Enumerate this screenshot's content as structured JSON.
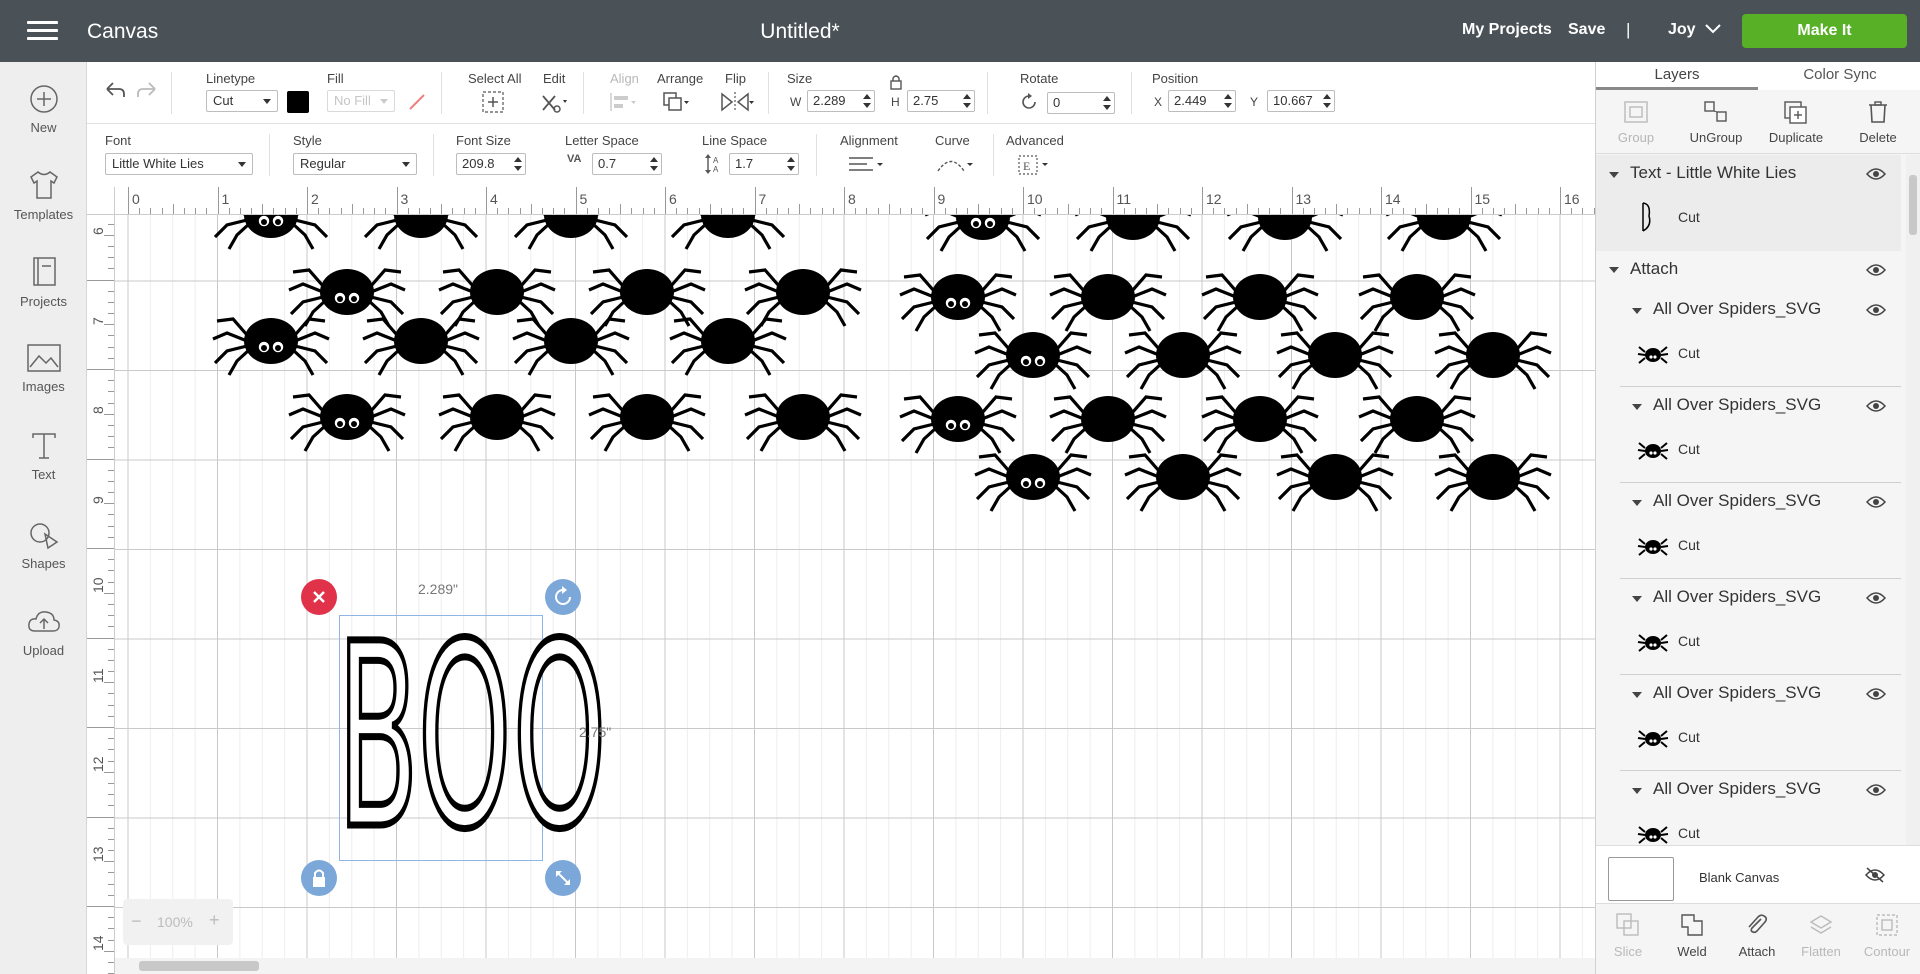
{
  "header": {
    "app_name": "Canvas",
    "doc_title": "Untitled*",
    "my_projects": "My Projects",
    "save": "Save",
    "separator": "|",
    "user": "Joy",
    "make_it": "Make It"
  },
  "sidebar": {
    "items": [
      {
        "label": "New",
        "icon": "plus-circle-icon"
      },
      {
        "label": "Templates",
        "icon": "shirt-icon"
      },
      {
        "label": "Projects",
        "icon": "book-icon"
      },
      {
        "label": "Images",
        "icon": "image-icon"
      },
      {
        "label": "Text",
        "icon": "text-icon"
      },
      {
        "label": "Shapes",
        "icon": "shapes-icon"
      },
      {
        "label": "Upload",
        "icon": "cloud-upload-icon"
      }
    ]
  },
  "toolbar1": {
    "linetype_label": "Linetype",
    "linetype_value": "Cut",
    "fill_label": "Fill",
    "fill_value": "No Fill",
    "select_all": "Select All",
    "edit": "Edit",
    "align": "Align",
    "arrange": "Arrange",
    "flip": "Flip",
    "size_label": "Size",
    "w_label": "W",
    "w_value": "2.289",
    "h_label": "H",
    "h_value": "2.75",
    "rotate_label": "Rotate",
    "rotate_value": "0",
    "position_label": "Position",
    "x_label": "X",
    "x_value": "2.449",
    "y_label": "Y",
    "y_value": "10.667",
    "color_swatch": "#000000"
  },
  "toolbar2": {
    "font_label": "Font",
    "font_value": "Little White Lies",
    "style_label": "Style",
    "style_value": "Regular",
    "font_size_label": "Font Size",
    "font_size_value": "209.8",
    "letter_space_label": "Letter Space",
    "letter_space_value": "0.7",
    "line_space_label": "Line Space",
    "line_space_value": "1.7",
    "alignment_label": "Alignment",
    "curve_label": "Curve",
    "advanced_label": "Advanced",
    "va_label": "VA"
  },
  "canvas": {
    "ruler_top": [
      "0",
      "1",
      "2",
      "3",
      "4",
      "5",
      "6",
      "7",
      "8",
      "9",
      "10",
      "11",
      "12",
      "13",
      "14",
      "15",
      "16"
    ],
    "ruler_left": [
      "6",
      "7",
      "8",
      "9",
      "10",
      "11",
      "12",
      "13",
      "14"
    ],
    "selected_text": "BOO",
    "width_label": "2.289\"",
    "height_label": "2.75\"",
    "zoom": "100%",
    "zoom_minus": "−",
    "zoom_plus": "+"
  },
  "panel": {
    "tabs": [
      "Layers",
      "Color Sync"
    ],
    "actions": [
      {
        "label": "Group",
        "disabled": true
      },
      {
        "label": "UnGroup",
        "disabled": false
      },
      {
        "label": "Duplicate",
        "disabled": false
      },
      {
        "label": "Delete",
        "disabled": false
      }
    ],
    "text_layer": {
      "title": "Text - Little White Lies",
      "sub": "Cut"
    },
    "attach_group": "Attach",
    "spider_layers": [
      {
        "title": "All Over Spiders_SVG",
        "sub": "Cut"
      },
      {
        "title": "All Over Spiders_SVG",
        "sub": "Cut"
      },
      {
        "title": "All Over Spiders_SVG",
        "sub": "Cut"
      },
      {
        "title": "All Over Spiders_SVG",
        "sub": "Cut"
      },
      {
        "title": "All Over Spiders_SVG",
        "sub": "Cut"
      },
      {
        "title": "All Over Spiders_SVG",
        "sub": "Cut"
      }
    ],
    "blank_canvas": "Blank Canvas",
    "bottom": [
      {
        "label": "Slice",
        "disabled": true
      },
      {
        "label": "Weld",
        "disabled": false
      },
      {
        "label": "Attach",
        "disabled": false
      },
      {
        "label": "Flatten",
        "disabled": true
      },
      {
        "label": "Contour",
        "disabled": true
      }
    ]
  },
  "colors": {
    "header_bg": "#4a5257",
    "make_it_green": "#58b026",
    "delete_handle": "#e0334a",
    "handle_blue": "#7ba7d9"
  }
}
